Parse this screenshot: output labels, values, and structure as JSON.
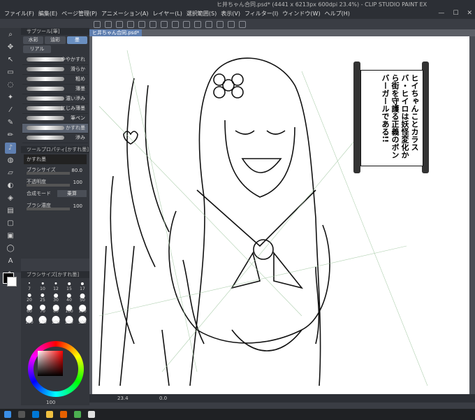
{
  "window": {
    "title": "ヒ井ちゃん合同.psd* (4441 x 6213px 600dpi 23.4%) - CLIP STUDIO PAINT EX"
  },
  "menu": {
    "items": [
      "ファイル(F)",
      "編集(E)",
      "ページ管理(P)",
      "アニメーション(A)",
      "レイヤー(L)",
      "選択範囲(S)",
      "表示(V)",
      "フィルター(I)",
      "ウィンドウ(W)",
      "ヘルプ(H)"
    ]
  },
  "document_tab": "ヒ井ちゃん合同.psd*",
  "subtool": {
    "header": "サブツール[筆]",
    "tabs": [
      {
        "label": "水彩",
        "active": false
      },
      {
        "label": "油彩",
        "active": false
      },
      {
        "label": "墨",
        "active": true
      },
      {
        "label": "リアル",
        "active": false
      }
    ],
    "brushes": [
      {
        "name": "ややかすれ",
        "active": false
      },
      {
        "name": "滑らか",
        "active": false
      },
      {
        "name": "粗め",
        "active": false
      },
      {
        "name": "薄墨",
        "active": false
      },
      {
        "name": "濃い滲み",
        "active": false
      },
      {
        "name": "にじみ薄墨",
        "active": false
      },
      {
        "name": "筆ペン",
        "active": false
      },
      {
        "name": "かすれ墨",
        "active": true
      },
      {
        "name": "滲み",
        "active": false
      }
    ]
  },
  "tool_property": {
    "header": "ツールプロパティ[かすれ墨]",
    "current_brush": "かすれ墨",
    "rows": [
      {
        "label": "ブラシサイズ",
        "value": "80.0"
      },
      {
        "label": "不透明度",
        "value": "100"
      },
      {
        "label": "合成モード",
        "value": "乗算"
      },
      {
        "label": "ブラシ濃度",
        "value": "100"
      }
    ]
  },
  "brush_size_panel": {
    "header": "ブラシサイズ[かすれ墨]",
    "sizes": [
      "7",
      "10",
      "12",
      "15",
      "17",
      "20",
      "25",
      "30",
      "40",
      "50",
      "60",
      "70",
      "80",
      "100",
      "120",
      "150",
      "170",
      "200",
      "250",
      "300"
    ]
  },
  "canvas": {
    "zoom": "23.4",
    "angle": "0.0",
    "speech_text": "ヒイちゃんことカラスバ・ヒイロは妖怪変化から街を守護る正義のボンバーガールである!!"
  },
  "colors": {
    "accent": "#5f7fb0",
    "panel": "#33363c",
    "main_color": "#000000",
    "sub_color": "#ffffff"
  },
  "status": {
    "opacity_value": "100"
  }
}
